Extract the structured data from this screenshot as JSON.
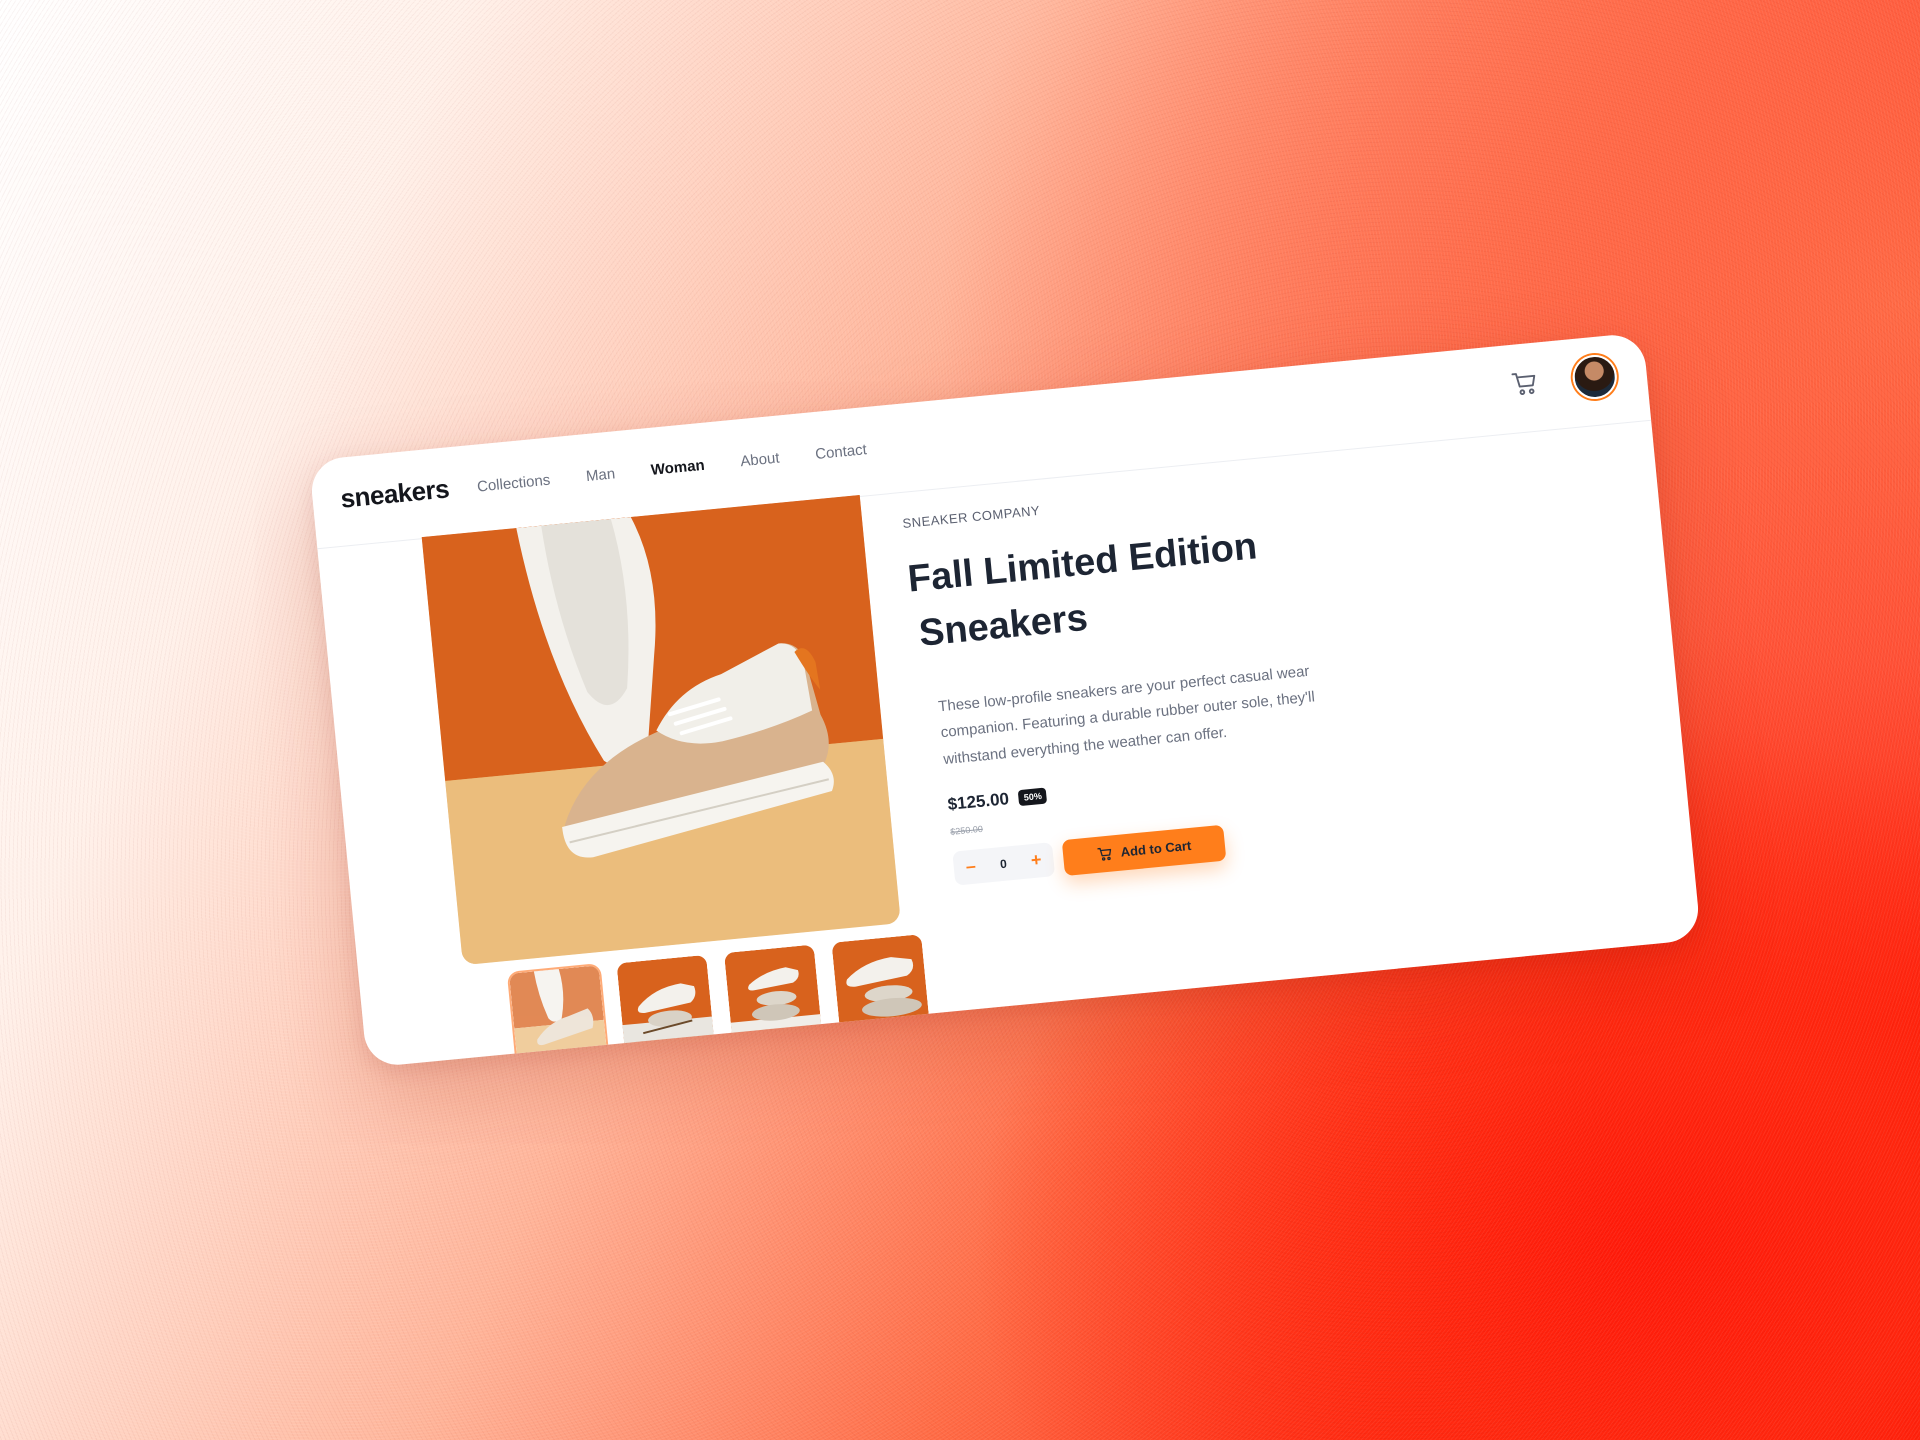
{
  "brand": {
    "logo": "sneakers"
  },
  "nav": {
    "links": [
      "Collections",
      "Man",
      "Woman",
      "About",
      "Contact"
    ],
    "active": "Woman"
  },
  "header_icons": {
    "cart": "cart-icon",
    "avatar": "avatar"
  },
  "product": {
    "company": "SNEAKER COMPANY",
    "title_line1": "Fall Limited Edition",
    "title_line2": "Sneakers",
    "description": "These low-profile sneakers are your perfect casual wear companion. Featuring a durable rubber outer sole, they'll withstand everything the weather can offer.",
    "price": "$125.00",
    "discount": "50%",
    "old_price": "$250.00",
    "quantity": "0",
    "minus_label": "–",
    "plus_label": "+",
    "add_to_cart": "Add to Cart"
  },
  "gallery": {
    "thumbnail_count": 4,
    "active_index": 0
  },
  "colors": {
    "accent": "#ff7e1b",
    "dark_text": "#1d2533",
    "muted_text": "#6b7180"
  }
}
